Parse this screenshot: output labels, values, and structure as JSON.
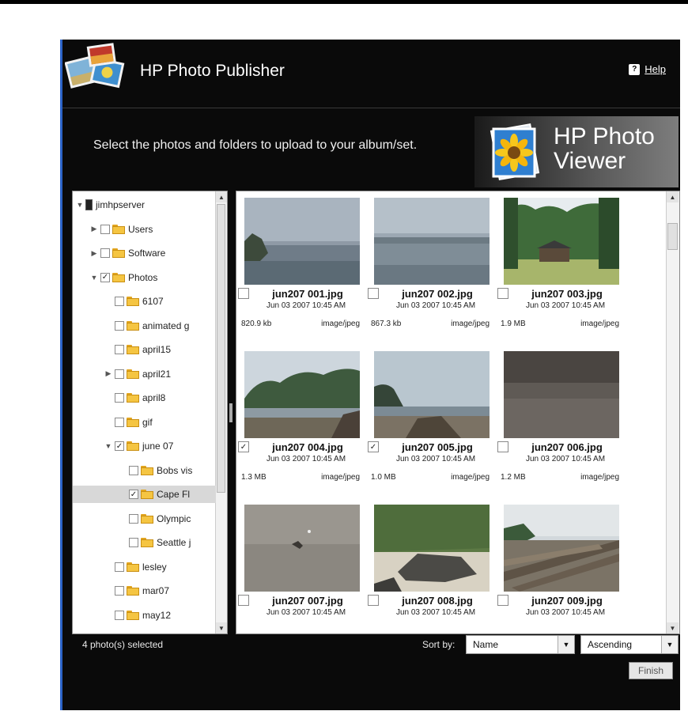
{
  "app": {
    "title": "HP Photo Publisher",
    "help_label": "Help"
  },
  "instruction": "Select the photos and folders to upload to your album/set.",
  "viewer_banner": {
    "line1": "HP Photo",
    "line2": "Viewer"
  },
  "tree": [
    {
      "label": "jimhpserver",
      "type": "server",
      "twisty": "expanded"
    },
    {
      "label": "Users",
      "twisty": "collapsed",
      "checked": false
    },
    {
      "label": "Software",
      "twisty": "collapsed",
      "checked": false
    },
    {
      "label": "Photos",
      "twisty": "expanded",
      "checked": true,
      "open": true
    },
    {
      "label": "6107",
      "checked": false
    },
    {
      "label": "animated g",
      "checked": false
    },
    {
      "label": "april15",
      "checked": false
    },
    {
      "label": "april21",
      "twisty": "collapsed",
      "checked": false
    },
    {
      "label": "april8",
      "checked": false
    },
    {
      "label": "gif",
      "checked": false
    },
    {
      "label": "june 07",
      "twisty": "expanded",
      "checked": true,
      "open": true
    },
    {
      "label": "Bobs vis",
      "checked": false
    },
    {
      "label": "Cape Fl",
      "checked": true,
      "selected": true
    },
    {
      "label": "Olympic",
      "checked": false
    },
    {
      "label": "Seattle j",
      "checked": false
    },
    {
      "label": "lesley",
      "checked": false
    },
    {
      "label": "mar07",
      "checked": false
    },
    {
      "label": "may12",
      "checked": false
    }
  ],
  "photos": [
    {
      "name": "jun207 001.jpg",
      "date": "Jun 03 2007 10:45 AM",
      "size": "820.9 kb",
      "type": "image/jpeg",
      "checked": false,
      "scene": "shore-fog"
    },
    {
      "name": "jun207 002.jpg",
      "date": "Jun 03 2007 10:45 AM",
      "size": "867.3 kb",
      "type": "image/jpeg",
      "checked": false,
      "scene": "ocean-fog"
    },
    {
      "name": "jun207 003.jpg",
      "date": "Jun 03 2007 10:45 AM",
      "size": "1.9 MB",
      "type": "image/jpeg",
      "checked": false,
      "scene": "forest-shelter"
    },
    {
      "name": "jun207 004.jpg",
      "date": "Jun 03 2007 10:45 AM",
      "size": "1.3 MB",
      "type": "image/jpeg",
      "checked": true,
      "scene": "beach-trees"
    },
    {
      "name": "jun207 005.jpg",
      "date": "Jun 03 2007 10:45 AM",
      "size": "1.0 MB",
      "type": "image/jpeg",
      "checked": true,
      "scene": "beach-rocks"
    },
    {
      "name": "jun207 006.jpg",
      "date": "Jun 03 2007 10:45 AM",
      "size": "1.2 MB",
      "type": "image/jpeg",
      "checked": false,
      "scene": "dark-sand"
    },
    {
      "name": "jun207 007.jpg",
      "date": "Jun 03 2007 10:45 AM",
      "size": "",
      "type": "",
      "checked": false,
      "scene": "grey-sand"
    },
    {
      "name": "jun207 008.jpg",
      "date": "Jun 03 2007 10:45 AM",
      "size": "",
      "type": "",
      "checked": false,
      "scene": "rocks-forest"
    },
    {
      "name": "jun207 009.jpg",
      "date": "Jun 03 2007 10:45 AM",
      "size": "",
      "type": "",
      "checked": false,
      "scene": "driftwood"
    }
  ],
  "footer": {
    "status": "4 photo(s) selected",
    "sort_label": "Sort by:",
    "sort_value": "Name",
    "order_value": "Ascending",
    "finish_label": "Finish"
  }
}
